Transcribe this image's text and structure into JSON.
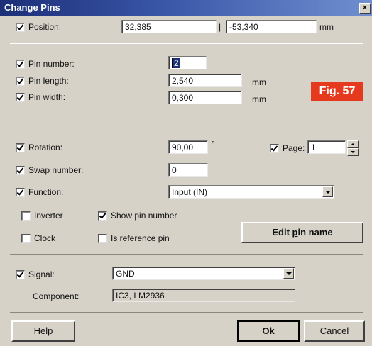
{
  "window": {
    "title": "Change Pins",
    "close_glyph": "×"
  },
  "badge": {
    "text": "Fig. 57",
    "color": "#e63a1e"
  },
  "position": {
    "label": "Position:",
    "checked": true,
    "x": "32,385",
    "separator": "|",
    "y": "-53,340",
    "unit": "mm"
  },
  "pin": {
    "number": {
      "label": "Pin number:",
      "checked": true,
      "value": "2"
    },
    "length": {
      "label": "Pin length:",
      "checked": true,
      "value": "2,540",
      "unit": "mm"
    },
    "width": {
      "label": "Pin width:",
      "checked": true,
      "value": "0,300",
      "unit": "mm"
    },
    "rotation": {
      "label": "Rotation:",
      "checked": true,
      "value": "90,00",
      "unit": "°"
    },
    "page": {
      "label": "Page:",
      "checked": true,
      "value": "1"
    },
    "swap": {
      "label": "Swap number:",
      "checked": true,
      "value": "0"
    },
    "function": {
      "label": "Function:",
      "checked": true,
      "value": "Input (IN)"
    },
    "inverter": {
      "label": "Inverter",
      "checked": false
    },
    "show_pin_number": {
      "label": "Show pin number",
      "checked": true
    },
    "clock": {
      "label": "Clock",
      "checked": false
    },
    "is_reference_pin": {
      "label": "Is reference pin",
      "checked": false
    },
    "edit_pin_name": {
      "pre": "Edit ",
      "mnemonic": "p",
      "post": "in name"
    }
  },
  "signal": {
    "label": "Signal:",
    "checked": true,
    "value": "GND"
  },
  "component": {
    "label": "Component:",
    "value": "IC3, LM2936"
  },
  "buttons": {
    "help": {
      "mnemonic": "H",
      "rest": "elp"
    },
    "ok": {
      "mnemonic": "O",
      "rest": "k"
    },
    "cancel": {
      "mnemonic": "C",
      "rest": "ancel"
    }
  }
}
